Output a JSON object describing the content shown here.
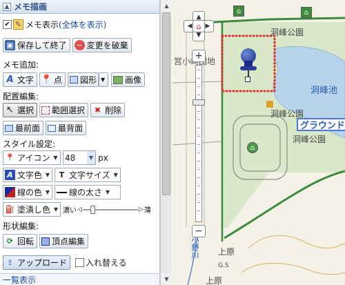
{
  "panel": {
    "title": "メモ描画",
    "show_memo": {
      "label": "メモ表示 ",
      "link": "(全体を表示)",
      "checked": true
    },
    "save_button": "保存して終了",
    "discard_button": "変更を破棄",
    "add_section": "メモ追加:",
    "add_text": "文字",
    "add_point": "点",
    "add_shape": "図形",
    "add_image": "画像",
    "layout_section": "配置編集:",
    "select": "選択",
    "range_select": "範囲選択",
    "delete": "削除",
    "bring_front": "最前面",
    "send_back": "最背面",
    "style_section": "スタイル設定:",
    "icon_select": "アイコン",
    "size_value": "48",
    "size_unit": "px",
    "text_color": "文字色",
    "text_size": "文字サイズ",
    "line_color": "線の色",
    "line_width": "線の太さ",
    "fill_color": "塗潰し色",
    "opacity_dark": "濃い",
    "opacity_light": "薄",
    "opacity_value": 0.15,
    "shape_section": "形状編集:",
    "rotate": "回転",
    "vertex_edit": "頂点編集",
    "upload": "アップロード",
    "replace": {
      "label": "入れ替える",
      "checked": false
    }
  },
  "footer": {
    "list_link": "一覧表示"
  },
  "map": {
    "labels": {
      "pond_park_top": "洞峰公園",
      "pond": "洞峰池",
      "pond_park_mid": "洞峰公園",
      "pond_park_low": "洞峰公園",
      "ground": "グラウンド",
      "school": "営小崎団地",
      "kamihara_a": "上原",
      "kamihara_b": "上原",
      "gs": "G.S",
      "river": "小野川"
    },
    "colors": {
      "park": "#d9e8c8",
      "water": "#b8d4ec",
      "road_green": "#3c8a3c",
      "boundary_red": "#e03030"
    }
  }
}
